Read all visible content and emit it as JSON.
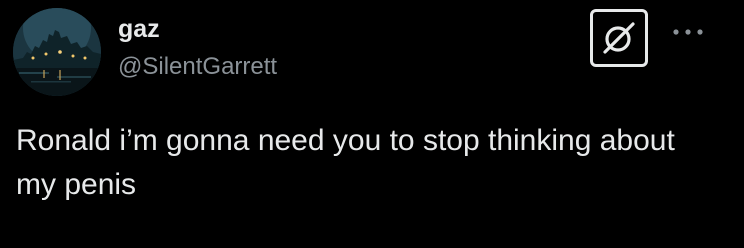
{
  "tweet": {
    "author": {
      "display_name": "gaz",
      "handle": "@SilentGarrett",
      "avatar_icon": "profile-photo"
    },
    "actions": {
      "grok_icon": "grok-icon",
      "more_icon": "more-options-icon"
    },
    "text": "Ronald i’m gonna need you to stop thinking about my penis"
  },
  "colors": {
    "background": "#000000",
    "text_primary": "#e7e9ea",
    "text_secondary": "#8b9298"
  }
}
